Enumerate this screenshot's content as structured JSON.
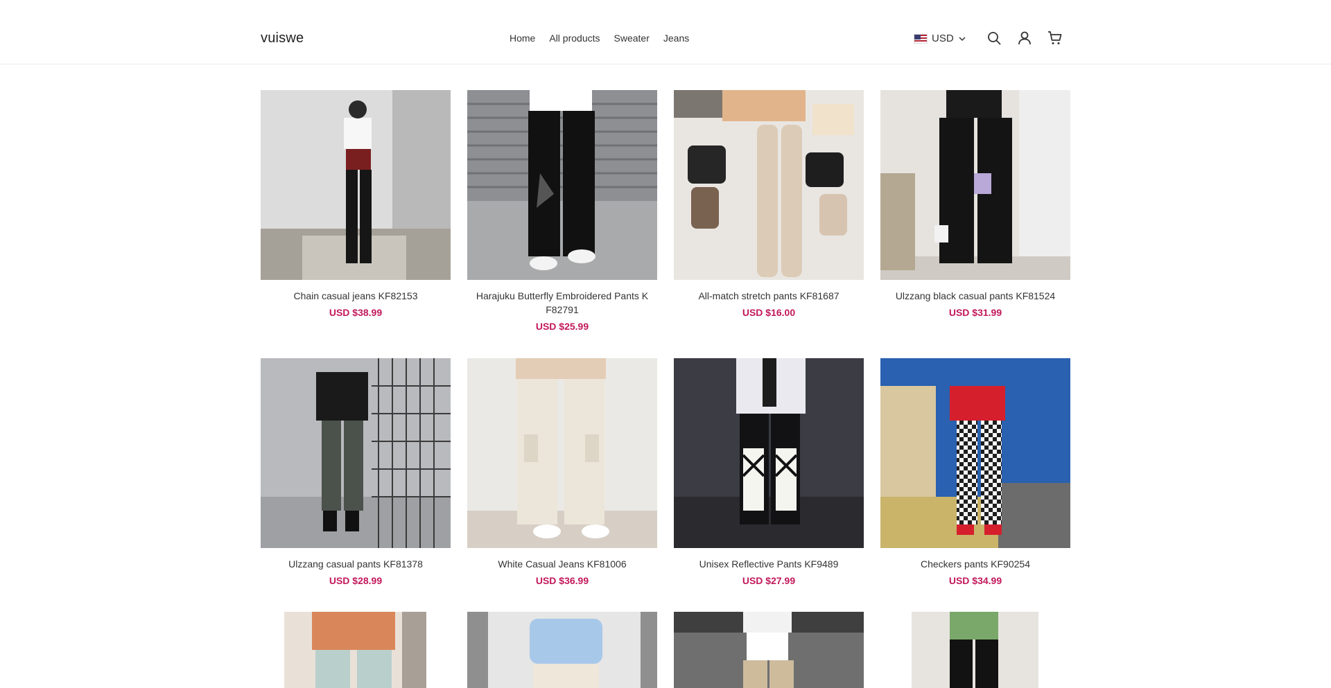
{
  "header": {
    "logo": "vuiswe",
    "nav": [
      "Home",
      "All products",
      "Sweater",
      "Jeans"
    ],
    "currency": "USD"
  },
  "icons": {
    "search": "search-icon",
    "account": "user-icon",
    "cart": "cart-icon",
    "flag": "us-flag-icon",
    "chevron": "chevron-down-icon"
  },
  "colors": {
    "price": "#c2185b",
    "text": "#333333",
    "border": "#ececec"
  },
  "products": [
    {
      "title": "Chain casual jeans KF82153",
      "price": "USD $38.99"
    },
    {
      "title": "Harajuku Butterfly Embroidered Pants K F82791",
      "price": "USD $25.99"
    },
    {
      "title": "All-match stretch pants KF81687",
      "price": "USD $16.00"
    },
    {
      "title": "Ulzzang black casual pants KF81524",
      "price": "USD $31.99"
    },
    {
      "title": "Ulzzang casual pants KF81378",
      "price": "USD $28.99"
    },
    {
      "title": "White Casual Jeans KF81006",
      "price": "USD $36.99"
    },
    {
      "title": "Unisex Reflective Pants KF9489",
      "price": "USD $27.99"
    },
    {
      "title": "Checkers pants KF90254",
      "price": "USD $34.99"
    }
  ]
}
